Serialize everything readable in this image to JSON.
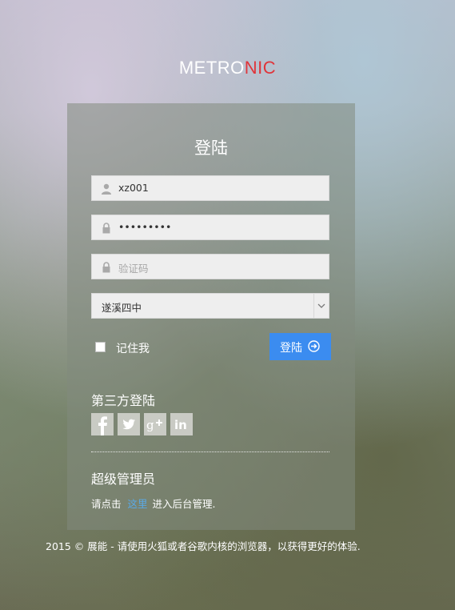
{
  "logo": {
    "part1": "METRO",
    "part2": "NIC"
  },
  "form": {
    "title": "登陆",
    "username_value": "xz001",
    "password_value": "•••••••••",
    "captcha_placeholder": "验证码",
    "school_selected": "遂溪四中",
    "remember_label": "记住我",
    "login_button": "登陆"
  },
  "social": {
    "title": "第三方登陆",
    "icons": [
      "facebook-icon",
      "twitter-icon",
      "googleplus-icon",
      "linkedin-icon"
    ]
  },
  "admin": {
    "title": "超级管理员",
    "prefix": "请点击",
    "link": "这里",
    "suffix": "进入后台管理."
  },
  "footer": {
    "text": "2015 © 展能 - 请使用火狐或者谷歌内核的浏览器，以获得更好的体验."
  },
  "colors": {
    "accent": "#3b8cf0",
    "logo_red": "#e0343a",
    "link": "#5aa9e6"
  }
}
